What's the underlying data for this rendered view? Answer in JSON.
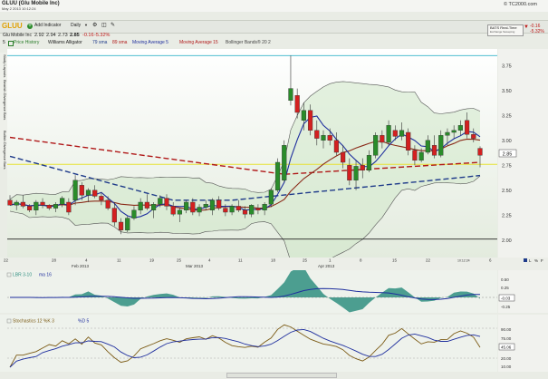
{
  "window": {
    "title": "GLUU (Glu Mobile Inc)",
    "datetime": "May 2 2013 10:12:24",
    "watermark": "© TC2000.com"
  },
  "toolbar": {
    "symbol": "GLUU",
    "add_indicator": "Add Indicator",
    "timeframe": "Daily"
  },
  "quote": {
    "name": "Glu Mobile Inc",
    "values": [
      "2.92",
      "2.94",
      "2.73",
      "2.85",
      "-0.16",
      "-5.32%"
    ]
  },
  "realtime": {
    "label": "BATS Real-Time",
    "sub": "Exchange Sweeping",
    "change": "-0.16",
    "pct": "-5.32%"
  },
  "legend": {
    "number": "5",
    "items": [
      "Price History",
      "Williams Alligator",
      "79 sma",
      "89 sma",
      "Moving Average 5",
      "Moving Average 15",
      "Bollinger Bands® 20 2"
    ],
    "colors": [
      "#2a7d2a",
      "#222222",
      "#1f3b8a",
      "#b01818",
      "#1f2f9e",
      "#b01818",
      "#444444"
    ]
  },
  "sidebar": {
    "tabs": [
      "Study Layouts",
      "Bearish Divergence Bars",
      "Bullish Divergence Bars"
    ]
  },
  "price_axis": {
    "ticks": [
      "3.75",
      "3.50",
      "3.25",
      "3.00",
      "2.75",
      "2.50",
      "2.25",
      "2.00"
    ],
    "last_price": "2.85"
  },
  "date_axis": {
    "ticks": [
      "22",
      "28",
      "4",
      "11",
      "19",
      "25",
      "4",
      "11",
      "18",
      "25",
      "1",
      "8",
      "15",
      "22",
      "6"
    ],
    "months": [
      "Feb 2013",
      "Mar 2013",
      "Apr 2013"
    ],
    "time": "10:12:24"
  },
  "lbr": {
    "label": "LBR 3-10",
    "ma": "ma 16",
    "ticks": [
      "0.50",
      "0.25",
      "-0.03",
      "-0.25"
    ]
  },
  "stoch": {
    "label": "Stochastics 12 %K 3",
    "d": "%D 5",
    "ticks": [
      "90.00",
      "75.00",
      "45.06",
      "20.00",
      "10.00"
    ]
  },
  "chart_controls": {
    "letters": [
      "L",
      "%",
      "F"
    ]
  },
  "chart_data": {
    "type": "candlestick",
    "ylim": [
      1.98,
      3.88
    ],
    "candles": [
      [
        2.4,
        2.45,
        2.35,
        2.35
      ],
      [
        2.35,
        2.4,
        2.3,
        2.38
      ],
      [
        2.38,
        2.45,
        2.32,
        2.34
      ],
      [
        2.34,
        2.36,
        2.28,
        2.3
      ],
      [
        2.3,
        2.4,
        2.25,
        2.38
      ],
      [
        2.38,
        2.42,
        2.32,
        2.35
      ],
      [
        2.35,
        2.36,
        2.3,
        2.32
      ],
      [
        2.32,
        2.38,
        2.28,
        2.36
      ],
      [
        2.36,
        2.44,
        2.33,
        2.42
      ],
      [
        2.38,
        2.42,
        2.25,
        2.28
      ],
      [
        2.4,
        2.65,
        2.35,
        2.6
      ],
      [
        2.55,
        2.58,
        2.4,
        2.45
      ],
      [
        2.45,
        2.52,
        2.38,
        2.5
      ],
      [
        2.5,
        2.55,
        2.42,
        2.44
      ],
      [
        2.44,
        2.48,
        2.35,
        2.4
      ],
      [
        2.4,
        2.44,
        2.3,
        2.32
      ],
      [
        2.32,
        2.38,
        2.14,
        2.18
      ],
      [
        2.18,
        2.22,
        2.06,
        2.1
      ],
      [
        2.1,
        2.24,
        2.08,
        2.22
      ],
      [
        2.22,
        2.34,
        2.2,
        2.3
      ],
      [
        2.3,
        2.42,
        2.26,
        2.38
      ],
      [
        2.38,
        2.46,
        2.3,
        2.32
      ],
      [
        2.3,
        2.38,
        2.22,
        2.36
      ],
      [
        2.36,
        2.45,
        2.33,
        2.42
      ],
      [
        2.42,
        2.46,
        2.3,
        2.34
      ],
      [
        2.34,
        2.38,
        2.24,
        2.26
      ],
      [
        2.26,
        2.32,
        2.18,
        2.3
      ],
      [
        2.3,
        2.4,
        2.27,
        2.38
      ],
      [
        2.38,
        2.42,
        2.25,
        2.28
      ],
      [
        2.28,
        2.36,
        2.24,
        2.33
      ],
      [
        2.33,
        2.4,
        2.3,
        2.36
      ],
      [
        2.3,
        2.42,
        2.25,
        2.4
      ],
      [
        2.4,
        2.44,
        2.3,
        2.32
      ],
      [
        2.32,
        2.36,
        2.24,
        2.28
      ],
      [
        2.28,
        2.36,
        2.25,
        2.34
      ],
      [
        2.34,
        2.4,
        2.28,
        2.3
      ],
      [
        2.3,
        2.34,
        2.22,
        2.26
      ],
      [
        2.26,
        2.36,
        2.23,
        2.35
      ],
      [
        2.32,
        2.36,
        2.26,
        2.3
      ],
      [
        2.3,
        2.38,
        2.25,
        2.36
      ],
      [
        2.36,
        2.52,
        2.33,
        2.5
      ],
      [
        2.5,
        2.82,
        2.48,
        2.78
      ],
      [
        2.6,
        3.0,
        2.58,
        2.95
      ],
      [
        3.4,
        3.85,
        3.35,
        3.52
      ],
      [
        3.45,
        3.52,
        3.22,
        3.28
      ],
      [
        3.2,
        3.38,
        3.1,
        3.3
      ],
      [
        3.3,
        3.36,
        3.05,
        3.1
      ],
      [
        3.1,
        3.2,
        2.95,
        3.02
      ],
      [
        3.0,
        3.1,
        2.92,
        3.05
      ],
      [
        3.05,
        3.12,
        2.95,
        3.0
      ],
      [
        3.0,
        3.08,
        2.85,
        2.88
      ],
      [
        2.88,
        2.95,
        2.72,
        2.78
      ],
      [
        2.75,
        2.82,
        2.55,
        2.6
      ],
      [
        2.6,
        2.8,
        2.5,
        2.74
      ],
      [
        2.75,
        2.82,
        2.62,
        2.7
      ],
      [
        2.7,
        2.9,
        2.68,
        2.85
      ],
      [
        2.85,
        3.08,
        2.82,
        3.05
      ],
      [
        3.05,
        3.1,
        2.92,
        2.98
      ],
      [
        2.98,
        3.2,
        2.95,
        3.15
      ],
      [
        3.1,
        3.15,
        3.0,
        3.04
      ],
      [
        3.04,
        3.18,
        3.0,
        3.1
      ],
      [
        3.08,
        3.12,
        2.85,
        2.9
      ],
      [
        2.9,
        2.95,
        2.75,
        2.8
      ],
      [
        2.8,
        2.92,
        2.78,
        2.88
      ],
      [
        2.88,
        3.05,
        2.86,
        3.0
      ],
      [
        2.95,
        3.05,
        2.82,
        2.85
      ],
      [
        2.85,
        3.1,
        2.83,
        3.05
      ],
      [
        3.05,
        3.12,
        2.95,
        3.08
      ],
      [
        3.08,
        3.15,
        3.02,
        3.1
      ],
      [
        3.1,
        3.2,
        3.05,
        3.15
      ],
      [
        3.2,
        3.28,
        3.02,
        3.06
      ],
      [
        3.06,
        3.12,
        2.98,
        3.02
      ],
      [
        2.92,
        2.94,
        2.73,
        2.85
      ]
    ]
  }
}
